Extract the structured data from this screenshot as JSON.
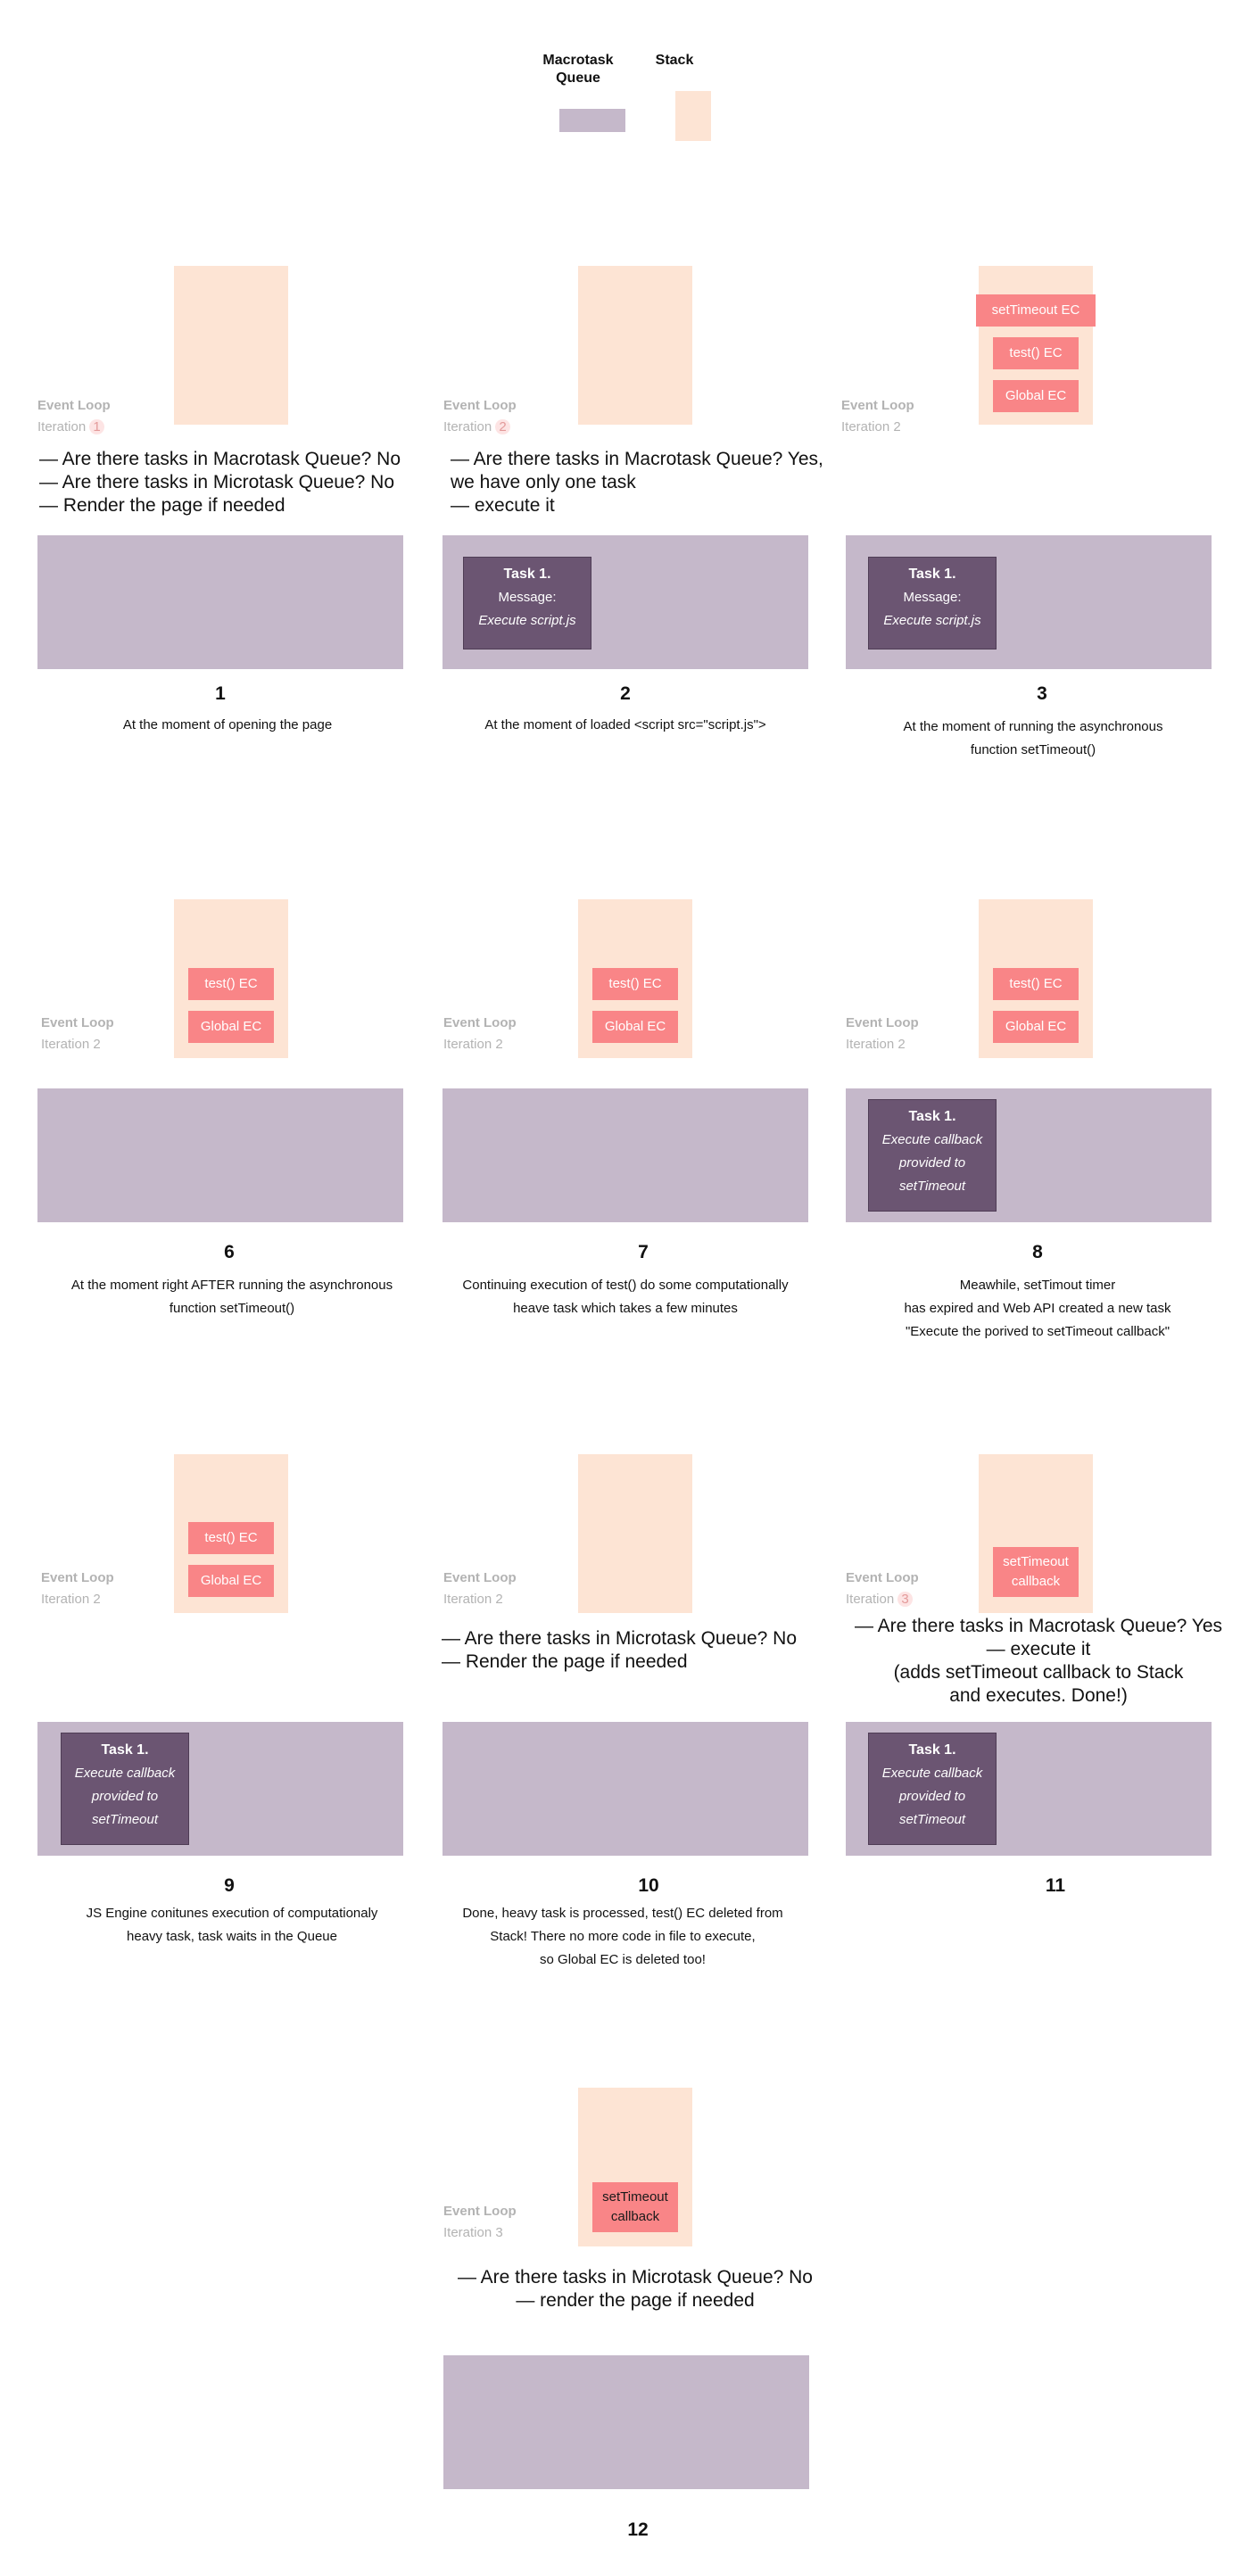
{
  "legend": {
    "macrotask_queue": "Macrotask Queue",
    "stack": "Stack",
    "colors": {
      "queue": "#c5b8ca",
      "stack": "#fde4d4",
      "ec": "#f98587",
      "task": "#6b5572"
    }
  },
  "panels": {
    "p1": {
      "event_loop": "Event Loop",
      "iteration_prefix": "Iteration",
      "iteration_num": "1",
      "questions": [
        "— Are there tasks in Macrotask Queue? No",
        "— Are there tasks in Microtask Queue? No",
        "— Render the page if needed"
      ],
      "number": "1",
      "caption": [
        "At the moment of opening the page"
      ]
    },
    "p2": {
      "event_loop": "Event Loop",
      "iteration_prefix": "Iteration",
      "iteration_num": "2",
      "questions": [
        "— Are there tasks in Macrotask Queue? Yes,",
        "we have only one task",
        "— execute it"
      ],
      "task": {
        "title": "Task 1.",
        "lines": [
          "Message:",
          "Execute script.js"
        ]
      },
      "number": "2",
      "caption": [
        "At the moment of loaded <script src=\"script.js\">"
      ]
    },
    "p3": {
      "event_loop": "Event Loop",
      "iteration": "Iteration 2",
      "stack_items": [
        "setTimeout EC",
        "test() EC",
        "Global EC"
      ],
      "task": {
        "title": "Task 1.",
        "lines": [
          "Message:",
          "Execute script.js"
        ]
      },
      "number": "3",
      "caption": [
        "At the moment of running the asynchronous",
        "function setTimeout()"
      ]
    },
    "p6": {
      "event_loop": "Event Loop",
      "iteration": "Iteration 2",
      "stack_items": [
        "test() EC",
        "Global EC"
      ],
      "number": "6",
      "caption": [
        "At the moment right AFTER running the asynchronous",
        "function setTimeout()"
      ]
    },
    "p7": {
      "event_loop": "Event Loop",
      "iteration": "Iteration 2",
      "stack_items": [
        "test() EC",
        "Global EC"
      ],
      "number": "7",
      "caption": [
        "Continuing execution of test() do some computationally",
        "heave task which takes a few minutes"
      ]
    },
    "p8": {
      "event_loop": "Event Loop",
      "iteration": "Iteration 2",
      "stack_items": [
        "test() EC",
        "Global EC"
      ],
      "task": {
        "title": "Task 1.",
        "lines": [
          "Execute callback",
          "provided to",
          "setTimeout"
        ]
      },
      "number": "8",
      "caption": [
        "Meawhile, setTimout timer",
        "has expired and Web API created a new task",
        "\"Execute the porived to setTimeout callback\""
      ]
    },
    "p9": {
      "event_loop": "Event Loop",
      "iteration": "Iteration 2",
      "stack_items": [
        "test() EC",
        "Global EC"
      ],
      "task": {
        "title": "Task 1.",
        "lines": [
          "Execute callback",
          "provided to",
          "setTimeout"
        ]
      },
      "number": "9",
      "caption": [
        "JS Engine conitunes execution of  computationaly",
        "heavy task, task waits in the Queue"
      ]
    },
    "p10": {
      "event_loop": "Event Loop",
      "iteration": "Iteration 2",
      "questions": [
        "— Are there tasks in Microtask Queue? No",
        "— Render the page if needed"
      ],
      "number": "10",
      "caption": [
        "Done, heavy task is processed, test() EC deleted from",
        "Stack! There no more code in file to execute,",
        "so Global EC is deleted too!"
      ]
    },
    "p11": {
      "event_loop": "Event Loop",
      "iteration_prefix": "Iteration",
      "iteration_num": "3",
      "stack_items": [
        "setTimeout callback"
      ],
      "questions": [
        "— Are there tasks in Macrotask Queue? Yes",
        "— execute it",
        "(adds setTimeout callback to Stack",
        "and executes. Done!)"
      ],
      "task": {
        "title": "Task 1.",
        "lines": [
          "Execute callback",
          "provided to",
          "setTimeout"
        ]
      },
      "number": "11"
    },
    "p12": {
      "event_loop": "Event Loop",
      "iteration": "Iteration 3",
      "stack_items": [
        "setTimeout callback"
      ],
      "questions": [
        "— Are there tasks in Microtask Queue? No",
        "— render the page if needed"
      ],
      "number": "12"
    }
  }
}
